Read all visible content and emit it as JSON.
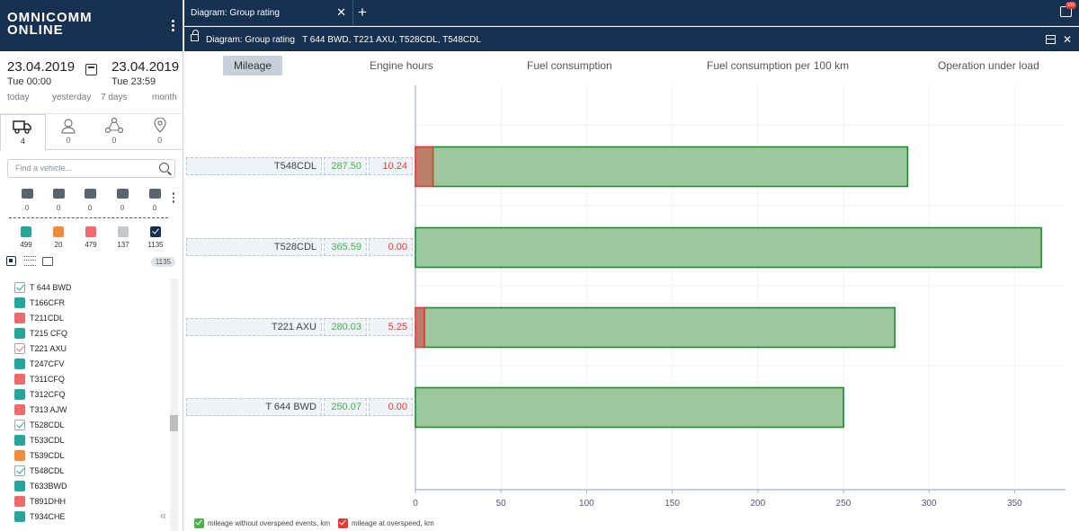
{
  "app": {
    "logo_line1": "OMNICOMM",
    "logo_line2": "ONLINE"
  },
  "period": {
    "from_date": "23.04.2019",
    "from_time": "Tue 00:00",
    "to_date": "23.04.2019",
    "to_time": "Tue 23:59",
    "quick": [
      "today",
      "yesterday",
      "7 days",
      "month"
    ]
  },
  "object_tabs": [
    {
      "icon": "truck-icon",
      "count": "4"
    },
    {
      "icon": "user-icon",
      "count": "0"
    },
    {
      "icon": "group-icon",
      "count": "0"
    },
    {
      "icon": "geofence-icon",
      "count": "0"
    }
  ],
  "search": {
    "placeholder": "Find a vehicle..."
  },
  "filters": [
    {
      "icon": "refuel-icon",
      "count": "0"
    },
    {
      "icon": "drain-icon",
      "count": "0"
    },
    {
      "icon": "moving-icon",
      "count": "0"
    },
    {
      "icon": "parking-icon",
      "count": "0"
    },
    {
      "icon": "fuel-station-icon",
      "count": "0"
    }
  ],
  "statuses": [
    {
      "color": "#26a69a",
      "count": "499"
    },
    {
      "color": "#f28b3c",
      "count": "20"
    },
    {
      "color": "#ef6b6b",
      "count": "479"
    },
    {
      "color": "#c3c8cd",
      "count": "137"
    },
    {
      "color": "#16304f",
      "count": "1135",
      "checked": true
    }
  ],
  "total_count": "1135",
  "vehicles": [
    {
      "name": "T 644 BWD",
      "color": "#26a69a",
      "checked": true
    },
    {
      "name": "T166CFR",
      "color": "#26a69a",
      "checked": false
    },
    {
      "name": "T211CDL",
      "color": "#ef6b6b",
      "checked": false
    },
    {
      "name": "T215 CFQ",
      "color": "#26a69a",
      "checked": false
    },
    {
      "name": "T221 AXU",
      "color": "#ef6b6b",
      "checked": true
    },
    {
      "name": "T247CFV",
      "color": "#26a69a",
      "checked": false
    },
    {
      "name": "T311CFQ",
      "color": "#ef6b6b",
      "checked": false
    },
    {
      "name": "T312CFQ",
      "color": "#26a69a",
      "checked": false
    },
    {
      "name": "T313 AJW",
      "color": "#ef6b6b",
      "checked": false
    },
    {
      "name": "T528CDL",
      "color": "#26a69a",
      "checked": true
    },
    {
      "name": "T533CDL",
      "color": "#26a69a",
      "checked": false
    },
    {
      "name": "T539CDL",
      "color": "#f28b3c",
      "checked": false
    },
    {
      "name": "T548CDL",
      "color": "#26a69a",
      "checked": true
    },
    {
      "name": "T633BWD",
      "color": "#26a69a",
      "checked": false
    },
    {
      "name": "T891DHH",
      "color": "#ef6b6b",
      "checked": false
    },
    {
      "name": "T934CHE",
      "color": "#26a69a",
      "checked": false
    }
  ],
  "tabbar": {
    "tab_title": "Diagram: Group rating",
    "notif_badge": "100"
  },
  "subbar": {
    "title": "Diagram: Group rating   T 644 BWD, T221 AXU, T528CDL, T548CDL"
  },
  "metric_tabs": [
    "Mileage",
    "Engine hours",
    "Fuel consumption",
    "Fuel consumption per 100 km",
    "Operation under load"
  ],
  "chart_data": {
    "type": "bar",
    "orientation": "horizontal",
    "stacked": true,
    "categories": [
      "T548CDL",
      "T528CDL",
      "T221 AXU",
      "T 644 BWD"
    ],
    "series": [
      {
        "name": "mileage without overspeed events, km",
        "values": [
          287.5,
          365.59,
          280.03,
          250.07
        ],
        "color": "#9dc89d",
        "stroke": "#1e8a32"
      },
      {
        "name": "mileage at overspeed, km",
        "values": [
          10.24,
          0.0,
          5.25,
          0.0
        ],
        "color": "#b97f6a",
        "stroke": "#e53935"
      }
    ],
    "value_labels": [
      "287.50",
      "365.59",
      "280.03",
      "250.07"
    ],
    "overspeed_labels": [
      "10.24",
      "0.00",
      "5.25",
      "0.00"
    ],
    "xlim": [
      0,
      380
    ],
    "xticks": [
      0,
      50,
      100,
      150,
      200,
      250,
      300,
      350
    ],
    "grid": true,
    "legend": "bottom-left"
  }
}
